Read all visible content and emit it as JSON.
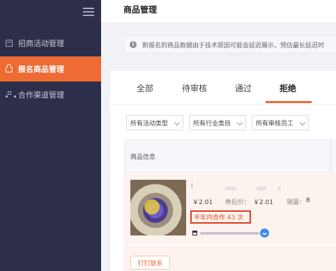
{
  "sidebar": {
    "items": [
      {
        "label": "招商活动管理",
        "icon": "calendar-icon"
      },
      {
        "label": "报名商品管理",
        "icon": "shopping-bag-icon",
        "active": true
      },
      {
        "label": "合作渠道管理",
        "icon": "network-icon"
      }
    ]
  },
  "header": {
    "title": "商品管理"
  },
  "notice": {
    "text": "新报名的商品数据由于技术原因可能会延迟展示，预估最长延迟时"
  },
  "tabs": [
    {
      "label": "全部"
    },
    {
      "label": "待审核"
    },
    {
      "label": "通过"
    },
    {
      "label": "拒绝",
      "active": true
    }
  ],
  "filters": [
    {
      "value": "所有活动类型"
    },
    {
      "value": "所有行业类目"
    },
    {
      "value": "所有审核员工"
    }
  ],
  "table": {
    "header": {
      "product_info": "商品信息"
    },
    "rows": [
      {
        "title_fragment": "(",
        "price": "￥2.01",
        "coupon_price_label": "券后价：",
        "coupon_price": "￥2.01",
        "sales_label": "销量：",
        "sales": "8",
        "cooperation": "半年内合作 43 次"
      }
    ]
  },
  "actions": {
    "dingding_contact": "钉钉联系"
  },
  "colors": {
    "accent": "#ee6b33",
    "sidebar_bg": "#2d2e4a",
    "highlight_border": "#e03a1e"
  }
}
